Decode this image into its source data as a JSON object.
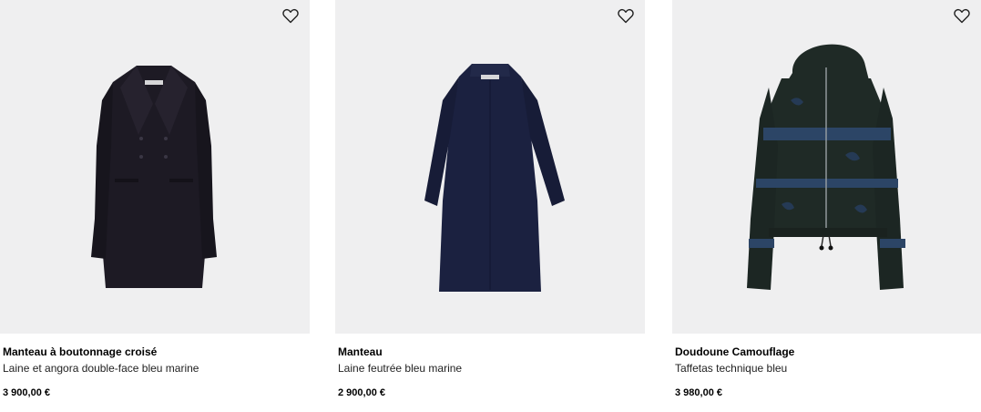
{
  "products": [
    {
      "name": "Manteau à boutonnage croisé",
      "description": "Laine et angora double-face bleu marine",
      "price": "3 900,00 €",
      "wishlist_icon": "heart-outline-icon",
      "colors": {
        "garment": "#1d1a24"
      }
    },
    {
      "name": "Manteau",
      "description": "Laine feutrée bleu marine",
      "price": "2 900,00 €",
      "wishlist_icon": "heart-outline-icon",
      "colors": {
        "garment": "#1b2140"
      }
    },
    {
      "name": "Doudoune Camouflage",
      "description": "Taffetas technique bleu",
      "price": "3 980,00 €",
      "wishlist_icon": "heart-outline-icon",
      "colors": {
        "garment": "#1f2a26",
        "accent": "#2c4566"
      }
    }
  ],
  "colors": {
    "image_background": "#efeff0",
    "text": "#000000"
  }
}
